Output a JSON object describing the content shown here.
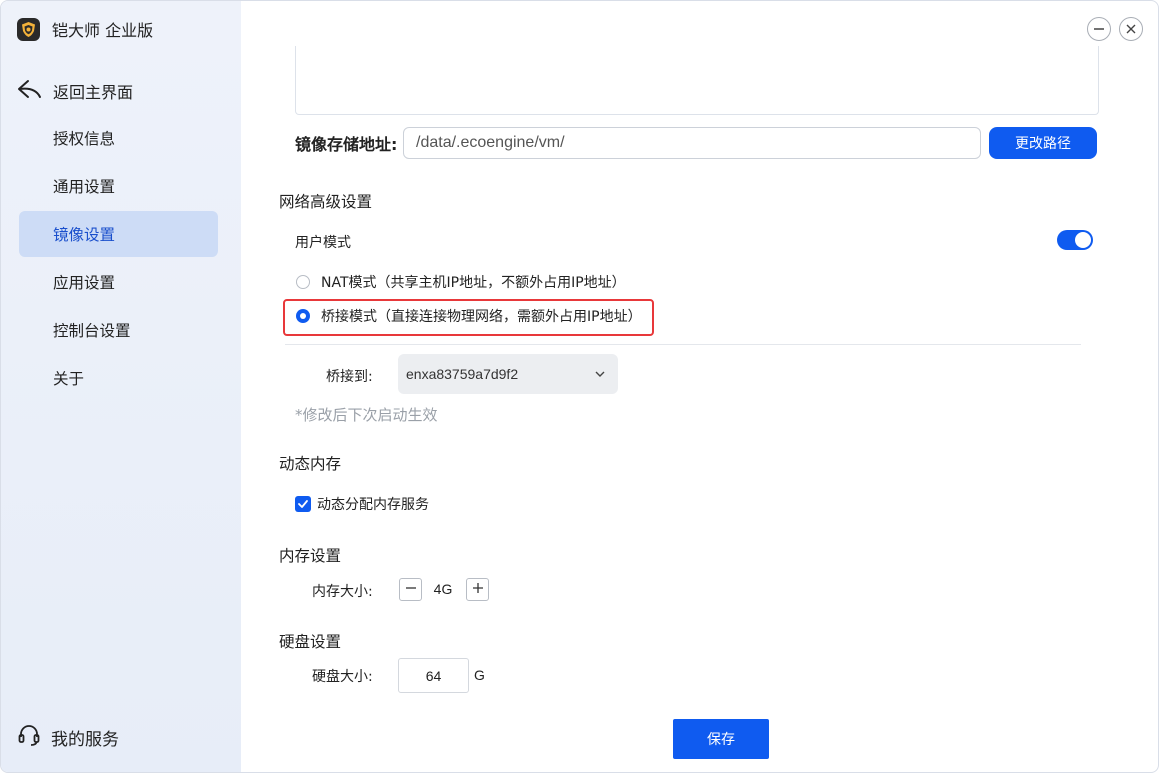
{
  "app": {
    "title": "铠大师 企业版"
  },
  "sidebar": {
    "back_label": "返回主界面",
    "items": [
      {
        "label": "授权信息",
        "active": false
      },
      {
        "label": "通用设置",
        "active": false
      },
      {
        "label": "镜像设置",
        "active": true
      },
      {
        "label": "应用设置",
        "active": false
      },
      {
        "label": "控制台设置",
        "active": false
      },
      {
        "label": "关于",
        "active": false
      }
    ],
    "service_label": "我的服务"
  },
  "storage": {
    "label": "镜像存储地址:",
    "path": "/data/.ecoengine/vm/",
    "change_button": "更改路径"
  },
  "network": {
    "title": "网络高级设置",
    "user_mode_label": "用户模式",
    "user_mode_on": true,
    "nat_label": "NAT模式（共享主机IP地址，不额外占用IP地址）",
    "bridge_label": "桥接模式（直接连接物理网络，需额外占用IP地址）",
    "selected": "bridge",
    "bridge_to_label": "桥接到:",
    "bridge_to_value": "enxa83759a7d9f2",
    "hint": "*修改后下次启动生效"
  },
  "dynamic_memory": {
    "title": "动态内存",
    "checkbox_label": "动态分配内存服务",
    "checked": true
  },
  "memory": {
    "title": "内存设置",
    "size_label": "内存大小:",
    "value": "4G"
  },
  "disk": {
    "title": "硬盘设置",
    "size_label": "硬盘大小:",
    "value": "64",
    "unit": "G"
  },
  "save_button": "保存",
  "colors": {
    "accent": "#0f5bf0",
    "highlight": "#e8383a",
    "sidebar_active": "#cddcf6"
  }
}
